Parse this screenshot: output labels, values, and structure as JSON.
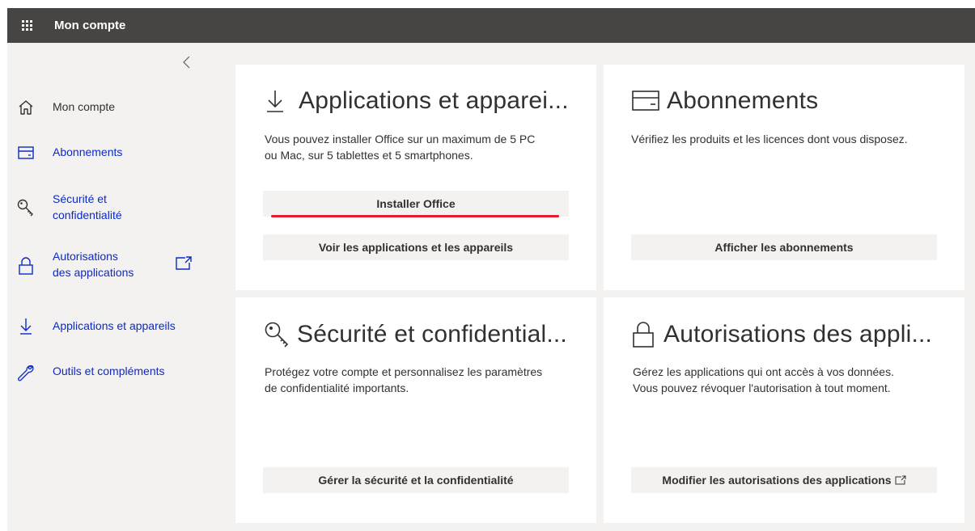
{
  "header": {
    "title": "Mon compte",
    "waffle_icon": "app-launcher-icon"
  },
  "sidebar": {
    "collapse_icon": "chevron-left-icon",
    "items": [
      {
        "label": "Mon compte",
        "icon": "home-icon"
      },
      {
        "label": "Abonnements",
        "icon": "card-icon"
      },
      {
        "label_line1": "Sécurité et",
        "label_line2": "confidentialité",
        "icon": "key-icon"
      },
      {
        "label_line1": "Autorisations",
        "label_line2": "des applications",
        "icon": "lock-icon",
        "external_icon": "open-external-icon"
      },
      {
        "label": "Applications et appareils",
        "icon": "download-icon"
      },
      {
        "label": "Outils et compléments",
        "icon": "wrench-icon"
      }
    ]
  },
  "cards": {
    "apps": {
      "title": "Applications et apparei...",
      "desc_line1": "Vous pouvez installer Office sur un maximum de 5 PC",
      "desc_line2": "ou Mac, sur 5 tablettes et 5 smartphones.",
      "primary_button": "Installer Office",
      "secondary_button": "Voir les applications et les appareils"
    },
    "subscriptions": {
      "title": "Abonnements",
      "desc_line1": "Vérifiez les produits et les licences dont vous disposez.",
      "button": "Afficher les abonnements"
    },
    "security": {
      "title": "Sécurité et confidential...",
      "desc_line1": "Protégez votre compte et personnalisez les paramètres",
      "desc_line2": "de confidentialité importants.",
      "button": "Gérer la sécurité et la confidentialité"
    },
    "permissions": {
      "title": "Autorisations des appli...",
      "desc_line1": "Gérez les applications qui ont accès à vos données.",
      "desc_line2": "Vous pouvez révoquer l'autorisation à tout moment.",
      "button": "Modifier les autorisations des applications"
    }
  },
  "colors": {
    "topbar": "#464543",
    "link": "#0b2ac7",
    "highlight": "#e41e2b",
    "background": "#f3f2f1"
  }
}
